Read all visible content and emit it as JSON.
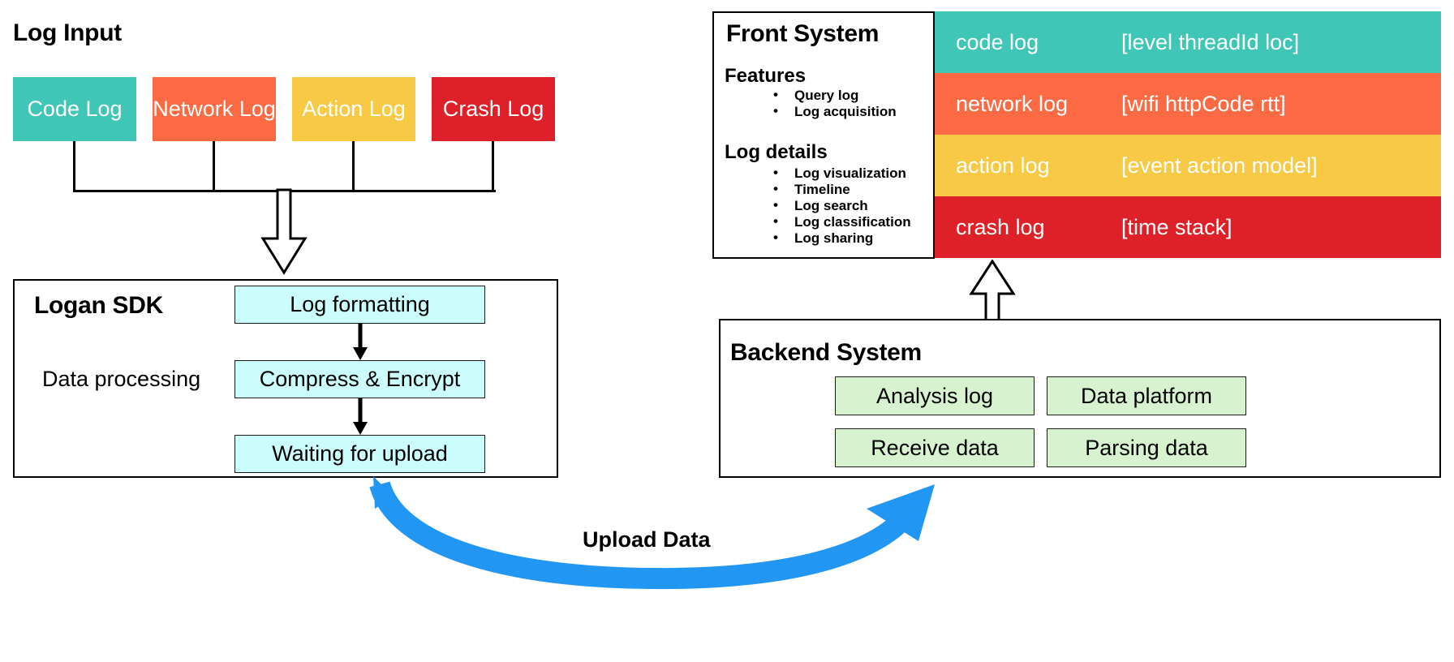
{
  "colors": {
    "teal": "#3fc6b7",
    "orange": "#fb6a43",
    "yellow": "#f8c944",
    "red": "#de2128",
    "cyan_fill": "#ccfdfd",
    "green_fill": "#d6f2ce",
    "blue_arrow": "#2196f3",
    "stroke": "#000000",
    "white": "#ffffff"
  },
  "log_input": {
    "title": "Log Input",
    "cards": [
      {
        "label": "Code Log",
        "color": "#3fc6b7"
      },
      {
        "label": "Network Log",
        "color": "#fb6a43"
      },
      {
        "label": "Action Log",
        "color": "#f8c944"
      },
      {
        "label": "Crash Log",
        "color": "#de2128"
      }
    ]
  },
  "logan_sdk": {
    "title": "Logan SDK",
    "side_label": "Data processing",
    "steps": [
      {
        "label": "Log formatting"
      },
      {
        "label": "Compress & Encrypt"
      },
      {
        "label": "Waiting for upload"
      }
    ]
  },
  "front_system": {
    "title": "Front System",
    "groups": [
      {
        "heading": "Features",
        "items": [
          "Query log",
          "Log acquisition"
        ]
      },
      {
        "heading": "Log details",
        "items": [
          "Log visualization",
          "Timeline",
          "Log search",
          "Log classification",
          "Log sharing"
        ]
      }
    ],
    "log_rows": [
      {
        "name": "code log",
        "tag": "[level threadId loc]",
        "color": "#3fc6b7"
      },
      {
        "name": "network log",
        "tag": "[wifi httpCode rtt]",
        "color": "#fb6a43"
      },
      {
        "name": "action log",
        "tag": "[event action model]",
        "color": "#f8c944"
      },
      {
        "name": "crash log",
        "tag": "[time stack]",
        "color": "#de2128"
      }
    ]
  },
  "backend_system": {
    "title": "Backend System",
    "boxes": [
      {
        "label": "Analysis log"
      },
      {
        "label": "Data platform"
      },
      {
        "label": "Receive data"
      },
      {
        "label": "Parsing data"
      }
    ]
  },
  "upload_flow": {
    "label": "Upload Data"
  }
}
